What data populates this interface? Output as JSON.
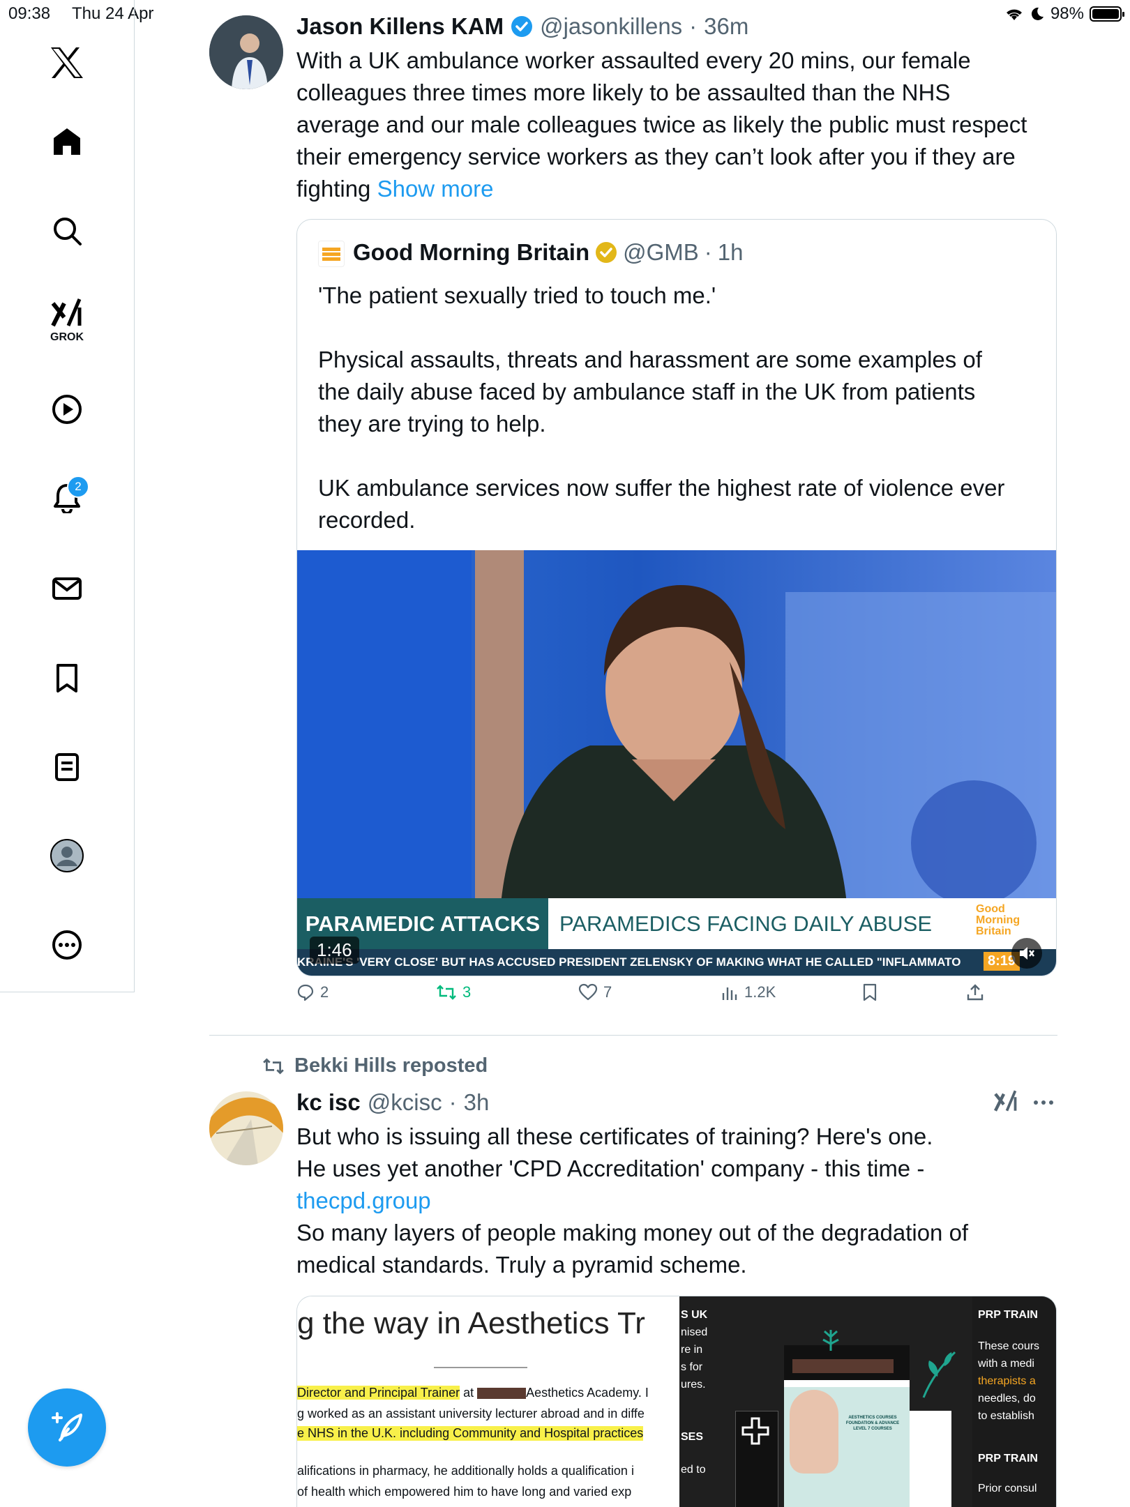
{
  "status_bar": {
    "time": "09:38",
    "date": "Thu 24 Apr",
    "battery": "98%"
  },
  "sidebar": {
    "grok_label": "GROK",
    "notifications_badge": "2"
  },
  "tweet1": {
    "author_name": "Jason Killens KAM",
    "handle": "@jasonkillens",
    "time": "36m",
    "separator": "·",
    "lines": [
      "With a UK ambulance worker assaulted every 20 mins, our female",
      "colleagues three times more likely to be assaulted than the NHS",
      "average and our male colleagues twice as likely the public must respect",
      "their emergency service workers as they can’t look after you if they are"
    ],
    "last_line_text": "fighting",
    "show_more": "Show more",
    "quote": {
      "name": "Good Morning Britain",
      "handle": "@GMB",
      "time": "1h",
      "logo_text": "Good Morning Britain",
      "p1": "'The patient sexually tried to touch me.'",
      "p2_lines": [
        "Physical assaults, threats and harassment are some examples of",
        "the daily abuse faced by ambulance staff in the UK from patients",
        "they are trying to help."
      ],
      "p3_lines": [
        "UK ambulance services now suffer the highest rate of violence ever",
        "recorded."
      ],
      "video": {
        "banner_left": "PARAMEDIC ATTACKS",
        "banner_right": "PARAMEDICS FACING DAILY ABUSE",
        "ticker": "KRAINE'S 'VERY CLOSE' BUT HAS ACCUSED PRESIDENT ZELENSKY OF MAKING WHAT HE CALLED \"INFLAMMATO",
        "duration": "1:46",
        "clock": "8:19",
        "gmb_logo": "Good Morning Britain"
      }
    },
    "actions": {
      "replies": "2",
      "reposts": "3",
      "likes": "7",
      "views": "1.2K"
    }
  },
  "tweet2": {
    "repost_label": "Bekki Hills reposted",
    "author_name": "kc isc",
    "handle": "@kcisc",
    "time": "3h",
    "separator": "·",
    "line1": "But who is issuing all these certificates of training?  Here's one.",
    "line2": "He uses yet another 'CPD Accreditation' company - this time -",
    "link": "thecpd.group",
    "line4": "So many layers of people making money out of the  degradation of",
    "line5": "medical standards. Truly a pyramid  scheme.",
    "media": {
      "heading": "g the way in Aesthetics Tr",
      "hl1_a": "Director and Principal Trainer",
      "hl1_b": " at ",
      "hl1_c": "Aesthetics Academy. I",
      "line_2": "g worked as an assistant university lecturer abroad and in diffe",
      "hl3": "e NHS in the U.K. including Community and Hospital practices",
      "line_4": "alifications in pharmacy, he additionally holds a qualification i",
      "line_5": "of health which empowered him to have long and varied exp",
      "mid_col": [
        "S UK",
        "nised",
        "re in",
        "s for",
        "ures.",
        "SES",
        "ed to"
      ],
      "poster_title": "AESTHETICS COURSES FOUNDATION & ADVANCE LEVEL 7 COURSES",
      "right_title1": "PRP TRAIN",
      "right_body": [
        "These cours",
        "with a medi",
        "therapists a",
        "needles, do",
        "to establish"
      ],
      "right_title2": "PRP TRAIN",
      "right_body2": "Prior consul"
    }
  },
  "colors": {
    "accent": "#1d9bf0",
    "repost_green": "#00ba7c",
    "verified_gold": "#e2b719",
    "banner_teal": "#1b5e63"
  }
}
